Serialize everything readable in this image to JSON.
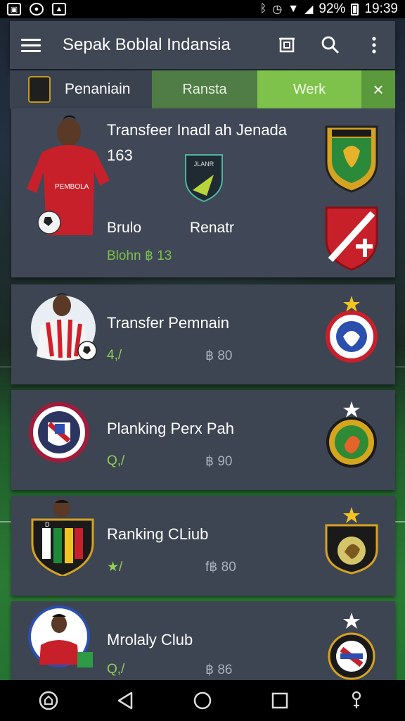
{
  "status_bar": {
    "battery": "92%",
    "time": "19:39",
    "icons": [
      "notification-icon",
      "media-icon",
      "gallery-icon",
      "bluetooth-icon",
      "alarm-icon",
      "wifi-icon",
      "signal-icon",
      "battery-icon"
    ]
  },
  "app_bar": {
    "title": "Sepak Boblal Indansia",
    "actions": [
      "crop-icon",
      "search-icon",
      "overflow-icon"
    ]
  },
  "tabs": {
    "home_label": "Penaniain",
    "tab_a": "Ransta",
    "tab_b": "Werk",
    "close": "×"
  },
  "featured": {
    "title": "Transfeer Inadl ah Jenada",
    "subtitle": "163",
    "left_label": "Brulo",
    "right_label": "Renatr",
    "footer": "Blohn ฿ 13",
    "center_logo_text": "JLANR"
  },
  "rows": [
    {
      "title": "Transfer Pemnain",
      "left": "4,/",
      "right": "฿ 80"
    },
    {
      "title": "Planking Perx Pah",
      "left": "Q,/",
      "right": "฿ 90"
    },
    {
      "title": "Ranking CLiub",
      "left": "★/",
      "right": "f฿ 80"
    },
    {
      "title": "Mrolaly Club",
      "left": "Q,/",
      "right": "฿ 86"
    }
  ],
  "colors": {
    "accent_green": "#7ec24c",
    "card_bg": "#3d4452",
    "appbar_bg": "#3f4654"
  }
}
